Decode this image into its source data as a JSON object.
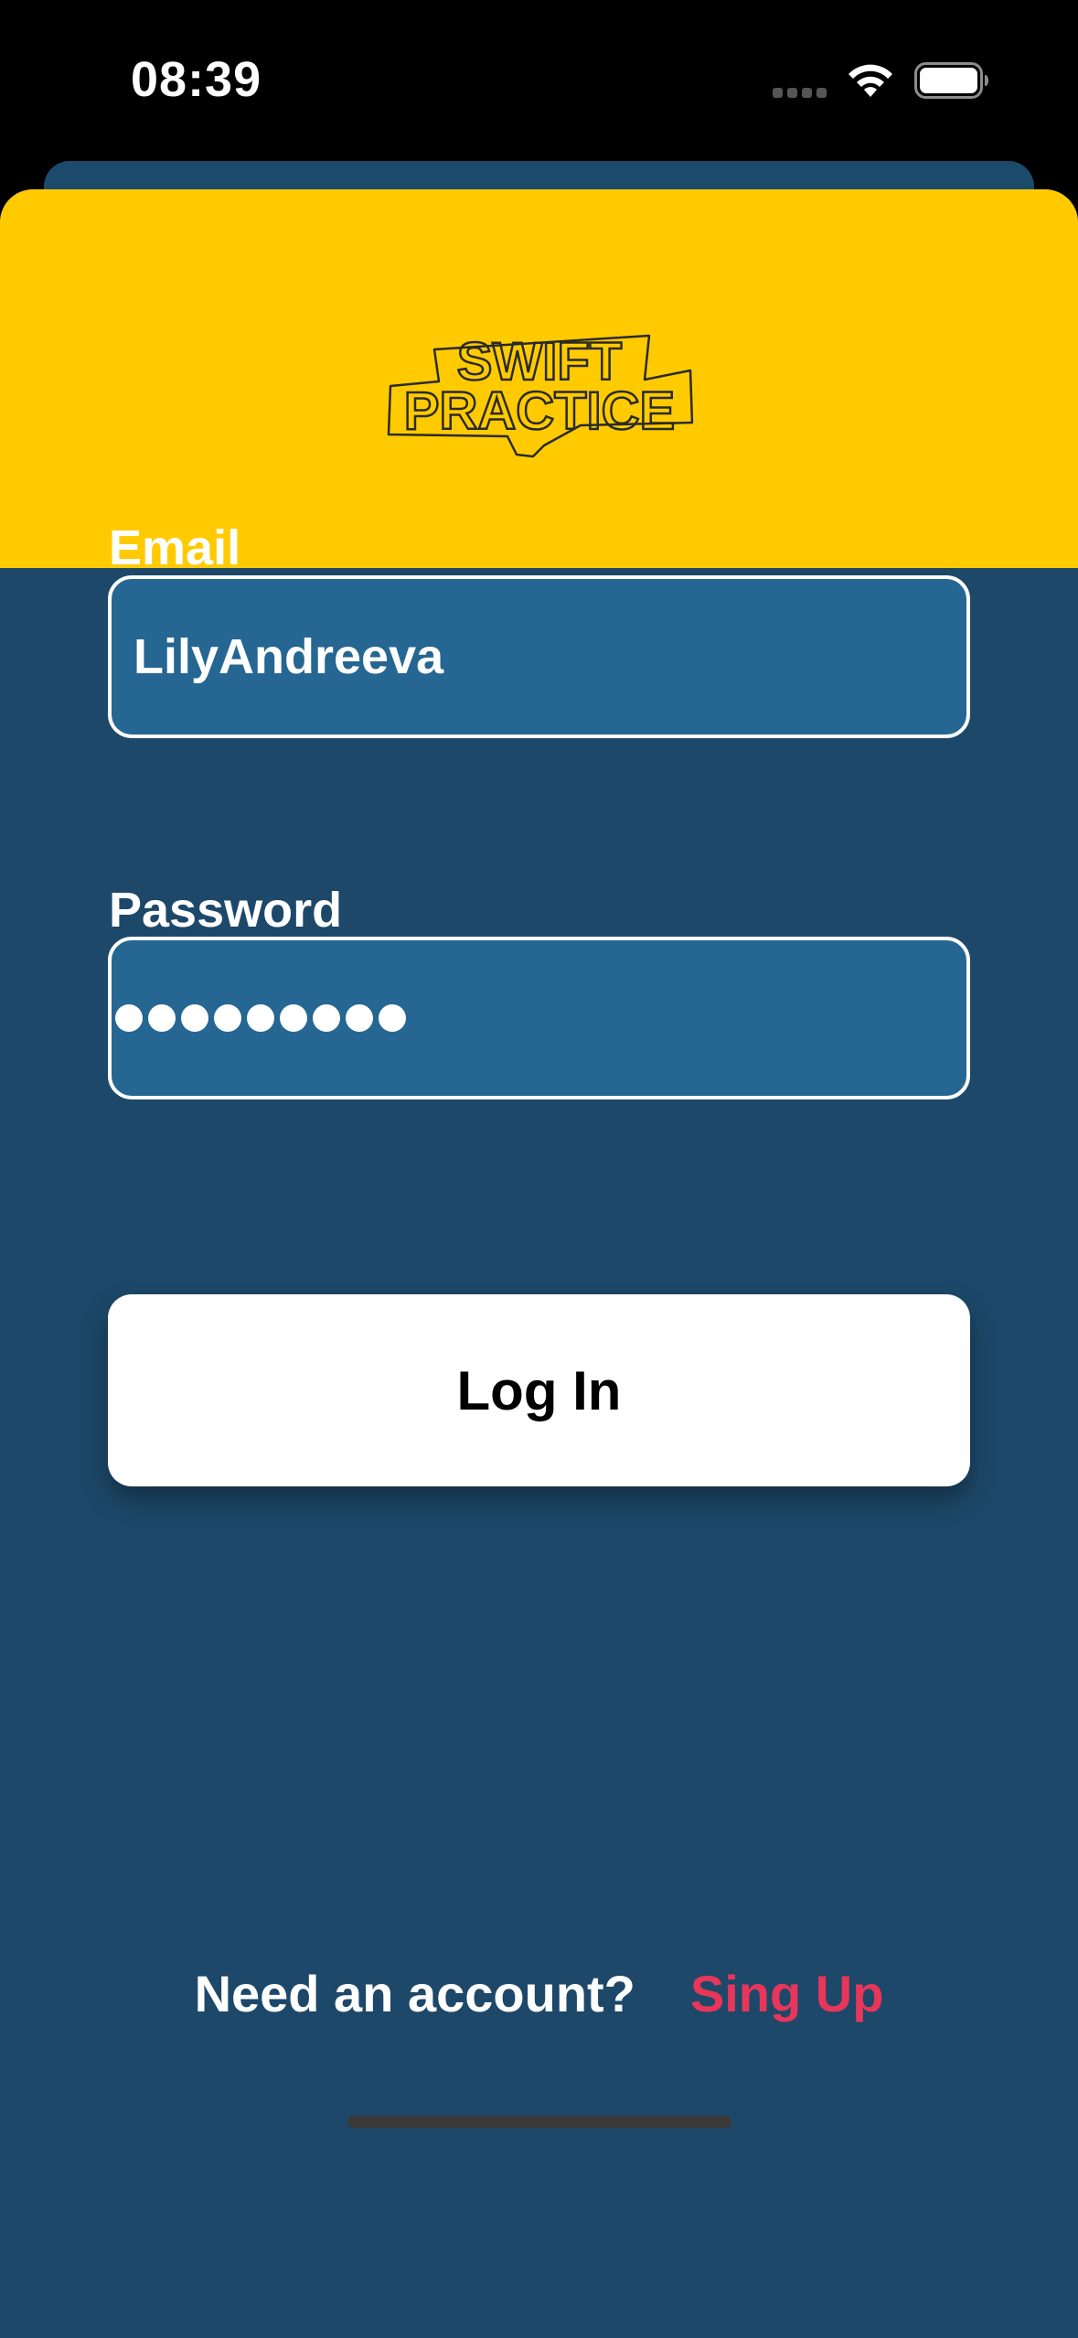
{
  "status_bar": {
    "time": "08:39"
  },
  "header": {
    "logo_line1": "SWIFT",
    "logo_line2": "PRACTICE",
    "background_color": "#ffcb00"
  },
  "form": {
    "email_label": "Email",
    "email_value": "LilyAndreeva",
    "password_label": "Password",
    "password_masked_count": 9,
    "login_label": "Log In"
  },
  "footer": {
    "prompt": "Need an account?",
    "signup_label": "Sing Up",
    "signup_color": "#e8365a"
  },
  "colors": {
    "background": "#1d4869",
    "field_fill": "#256692",
    "accent": "#ffcb00"
  },
  "icons": [
    "signal-icon",
    "wifi-icon",
    "battery-icon"
  ]
}
